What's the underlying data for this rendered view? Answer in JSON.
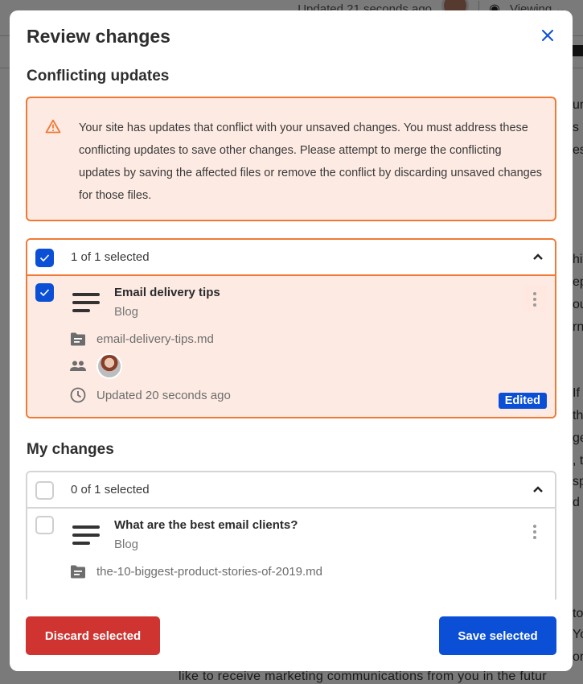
{
  "background": {
    "updated_text": "Updated 21 seconds ago",
    "viewing_label": "Viewing",
    "bottom_text": "like to receive marketing communications from you in the futur",
    "right_fragments": [
      "ur",
      "s i",
      "es",
      "hi",
      "ep",
      "ou",
      "rn",
      "If",
      "th",
      "ge",
      ", t",
      "sp",
      "d",
      "to",
      "Yo",
      "or"
    ]
  },
  "modal": {
    "title": "Review changes",
    "close_icon": "close-icon",
    "conflicting": {
      "section_title": "Conflicting updates",
      "warning_icon": "warning-triangle-icon",
      "warning_text": "Your site has updates that conflict with your unsaved changes. You must address these conflicting updates to save other changes. Please attempt to merge the conflicting updates by saving the affected files or remove the conflict by discarding unsaved changes for those files.",
      "selection_count": "1 of 1 selected",
      "all_checked": true,
      "expanded": true,
      "items": [
        {
          "title": "Email delivery tips",
          "type": "Blog",
          "filename": "email-delivery-tips.md",
          "updated": "Updated 20 seconds ago",
          "badge": "Edited",
          "checked": true
        }
      ]
    },
    "my_changes": {
      "section_title": "My changes",
      "selection_count": "0 of 1 selected",
      "all_checked": false,
      "expanded": true,
      "items": [
        {
          "title": "What are the best email clients?",
          "type": "Blog",
          "filename": "the-10-biggest-product-stories-of-2019.md",
          "checked": false
        }
      ]
    },
    "footer": {
      "discard_label": "Discard selected",
      "save_label": "Save selected"
    }
  },
  "colors": {
    "primary": "#0a4fd6",
    "danger": "#cf3430",
    "warning_border": "#f07a35",
    "warning_bg": "#fdeae3"
  }
}
